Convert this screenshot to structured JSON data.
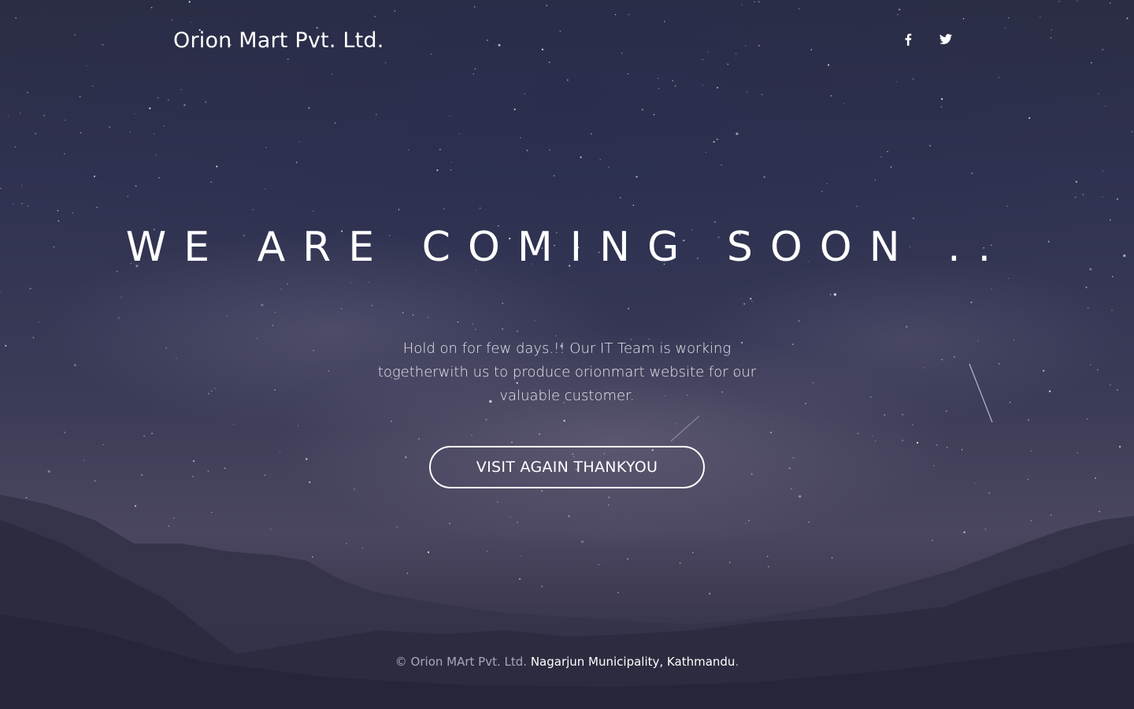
{
  "header": {
    "brand": "Orion Mart Pvt. Ltd.",
    "social": [
      {
        "icon": "facebook-icon"
      },
      {
        "icon": "twitter-icon"
      }
    ]
  },
  "hero": {
    "headline": "WE ARE COMING SOON ..",
    "message": "Hold on for few days.!! Our IT Team is working togetherwith us to produce orionmart website for our valuable customer.",
    "button_label": "VISIT AGAIN THANKYOU"
  },
  "footer": {
    "copyright": "© Orion MArt Pvt. Ltd.",
    "address_link": "Nagarjun Municipality, Kathmandu",
    "trailing": "."
  },
  "colors": {
    "sky_top": "#2b2d45",
    "sky_mid": "#3a3b57",
    "mountain": "#2a2a3c",
    "text": "#ffffff",
    "footer_muted": "#a7a8b8"
  }
}
